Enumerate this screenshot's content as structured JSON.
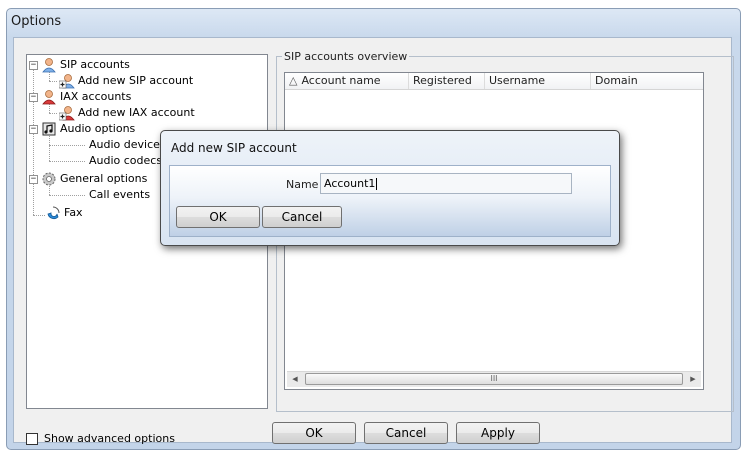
{
  "window": {
    "title": "Options"
  },
  "tree": {
    "items": [
      {
        "label": "SIP accounts",
        "icon": "sip-accounts-icon",
        "expander": "−"
      },
      {
        "label": "Add new SIP account",
        "icon": "add-account-icon"
      },
      {
        "label": "IAX accounts",
        "icon": "iax-accounts-icon",
        "expander": "−"
      },
      {
        "label": "Add new IAX account",
        "icon": "add-account-icon"
      },
      {
        "label": "Audio options",
        "icon": "audio-icon",
        "expander": "−"
      },
      {
        "label": "Audio devices"
      },
      {
        "label": "Audio codecs"
      },
      {
        "label": "General options",
        "icon": "gear-icon",
        "expander": "−"
      },
      {
        "label": "Call events"
      },
      {
        "label": "Fax",
        "icon": "fax-icon"
      }
    ]
  },
  "show_advanced": {
    "label": "Show advanced options",
    "checked": false
  },
  "overview": {
    "group_label": "SIP accounts overview",
    "columns": [
      "Account name",
      "Registered",
      "Username",
      "Domain"
    ],
    "sort_indicator": "△",
    "scroll_grip": "III"
  },
  "buttons": {
    "ok": "OK",
    "cancel": "Cancel",
    "apply": "Apply"
  },
  "dialog": {
    "title": "Add new SIP account",
    "name_label": "Name",
    "name_value": "Account1",
    "ok": "OK",
    "cancel": "Cancel"
  }
}
